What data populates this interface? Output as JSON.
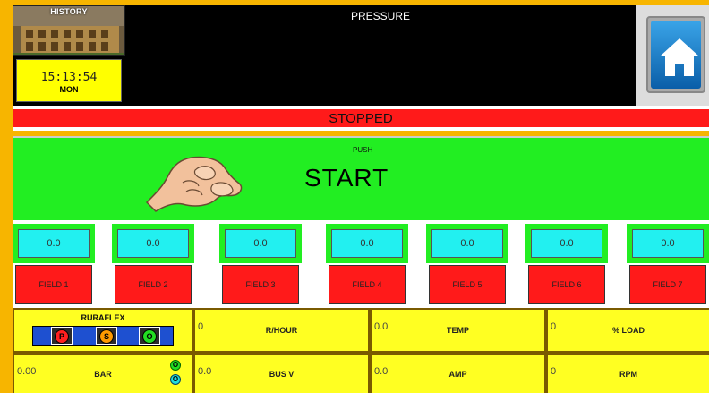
{
  "header": {
    "history_label": "HISTORY",
    "title": "PRESSURE",
    "clock": {
      "time": "15:13:54",
      "day": "MON"
    }
  },
  "status": {
    "text": "STOPPED",
    "color": "#ff1a1a"
  },
  "start": {
    "hint": "PUSH",
    "label": "START",
    "color": "#22ee22"
  },
  "fields": [
    {
      "value": "0.0",
      "label": "FIELD 1"
    },
    {
      "value": "0.0",
      "label": "FIELD 2"
    },
    {
      "value": "0.0",
      "label": "FIELD 3"
    },
    {
      "value": "0.0",
      "label": "FIELD 4"
    },
    {
      "value": "0.0",
      "label": "FIELD 5"
    },
    {
      "value": "0.0",
      "label": "FIELD 6"
    },
    {
      "value": "0.0",
      "label": "FIELD 7"
    }
  ],
  "ruraflex": {
    "title": "RURAFLEX",
    "buttons": [
      {
        "label": "P",
        "color": "#ff2020"
      },
      {
        "label": "S",
        "color": "#ff9a00"
      },
      {
        "label": "O",
        "color": "#22dd22"
      }
    ]
  },
  "metrics": {
    "rhour": {
      "value": "0",
      "label": "R/HOUR"
    },
    "temp": {
      "value": "0.0",
      "label": "TEMP"
    },
    "load": {
      "value": "0",
      "label": "% LOAD"
    },
    "bar": {
      "value": "0.00",
      "label": "BAR"
    },
    "busv": {
      "value": "0.0",
      "label": "BUS V"
    },
    "amp": {
      "value": "0.0",
      "label": "AMP"
    },
    "rpm": {
      "value": "0",
      "label": "RPM"
    }
  },
  "indicators": [
    {
      "label": "O",
      "color": "#22dd22"
    },
    {
      "label": "O",
      "color": "#22dddd"
    }
  ],
  "icons": [
    "history-image-icon",
    "home-icon",
    "pointing-hand-icon"
  ]
}
